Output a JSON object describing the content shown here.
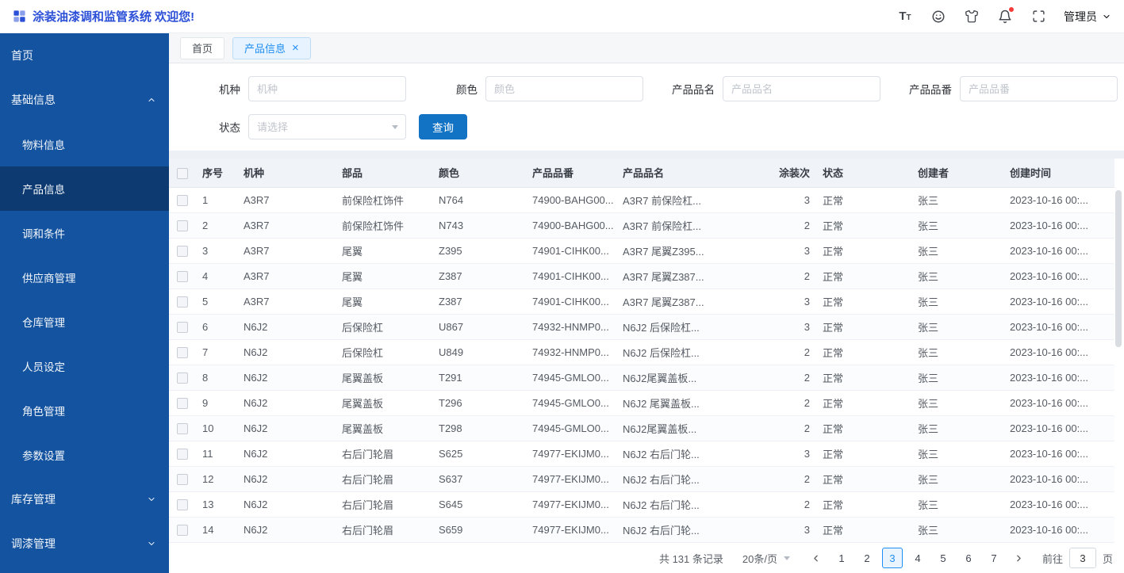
{
  "header": {
    "title": "涂装油漆调和监管系统 欢迎您!",
    "user_label": "管理员"
  },
  "sidebar": {
    "items": [
      {
        "label": "首页",
        "level": 1
      },
      {
        "label": "基础信息",
        "level": 1,
        "chevron": "up"
      },
      {
        "label": "物料信息",
        "level": 2
      },
      {
        "label": "产品信息",
        "level": 2,
        "active": true
      },
      {
        "label": "调和条件",
        "level": 2
      },
      {
        "label": "供应商管理",
        "level": 2
      },
      {
        "label": "仓库管理",
        "level": 2
      },
      {
        "label": "人员设定",
        "level": 2
      },
      {
        "label": "角色管理",
        "level": 2
      },
      {
        "label": "参数设置",
        "level": 2
      },
      {
        "label": "库存管理",
        "level": 1,
        "chevron": "down"
      },
      {
        "label": "调漆管理",
        "level": 1,
        "chevron": "down"
      }
    ]
  },
  "tabs": [
    {
      "label": "首页",
      "active": false,
      "closable": false
    },
    {
      "label": "产品信息",
      "active": true,
      "closable": true
    }
  ],
  "search": {
    "fields": [
      {
        "label": "机种",
        "placeholder": "机种"
      },
      {
        "label": "颜色",
        "placeholder": "颜色"
      },
      {
        "label": "产品品名",
        "placeholder": "产品品名"
      },
      {
        "label": "产品品番",
        "placeholder": "产品品番"
      }
    ],
    "status_label": "状态",
    "status_placeholder": "请选择",
    "query_label": "查询"
  },
  "table": {
    "columns": [
      {
        "key": "no",
        "label": "序号"
      },
      {
        "key": "model",
        "label": "机种"
      },
      {
        "key": "part",
        "label": "部品"
      },
      {
        "key": "color",
        "label": "颜色"
      },
      {
        "key": "part_no",
        "label": "产品品番"
      },
      {
        "key": "name",
        "label": "产品品名"
      },
      {
        "key": "times",
        "label": "涂装次",
        "align": "right"
      },
      {
        "key": "status",
        "label": "状态"
      },
      {
        "key": "creator",
        "label": "创建者"
      },
      {
        "key": "created",
        "label": "创建时间"
      }
    ],
    "rows": [
      {
        "no": "1",
        "model": "A3R7",
        "part": "前保险杠饰件",
        "color": "N764",
        "part_no": "74900-BAHG00...",
        "name": "A3R7 前保险杠...",
        "times": "3",
        "status": "正常",
        "creator": "张三",
        "created": "2023-10-16 00:..."
      },
      {
        "no": "2",
        "model": "A3R7",
        "part": "前保险杠饰件",
        "color": "N743",
        "part_no": "74900-BAHG00...",
        "name": "A3R7 前保险杠...",
        "times": "2",
        "status": "正常",
        "creator": "张三",
        "created": "2023-10-16 00:..."
      },
      {
        "no": "3",
        "model": "A3R7",
        "part": "尾翼",
        "color": "Z395",
        "part_no": "74901-CIHK00...",
        "name": "A3R7 尾翼Z395...",
        "times": "3",
        "status": "正常",
        "creator": "张三",
        "created": "2023-10-16 00:..."
      },
      {
        "no": "4",
        "model": "A3R7",
        "part": "尾翼",
        "color": "Z387",
        "part_no": "74901-CIHK00...",
        "name": "A3R7 尾翼Z387...",
        "times": "2",
        "status": "正常",
        "creator": "张三",
        "created": "2023-10-16 00:..."
      },
      {
        "no": "5",
        "model": "A3R7",
        "part": "尾翼",
        "color": "Z387",
        "part_no": "74901-CIHK00...",
        "name": "A3R7 尾翼Z387...",
        "times": "3",
        "status": "正常",
        "creator": "张三",
        "created": "2023-10-16 00:..."
      },
      {
        "no": "6",
        "model": "N6J2",
        "part": "后保险杠",
        "color": "U867",
        "part_no": "74932-HNMP0...",
        "name": "N6J2 后保险杠...",
        "times": "3",
        "status": "正常",
        "creator": "张三",
        "created": "2023-10-16 00:..."
      },
      {
        "no": "7",
        "model": "N6J2",
        "part": "后保险杠",
        "color": "U849",
        "part_no": "74932-HNMP0...",
        "name": "N6J2 后保险杠...",
        "times": "2",
        "status": "正常",
        "creator": "张三",
        "created": "2023-10-16 00:..."
      },
      {
        "no": "8",
        "model": "N6J2",
        "part": "尾翼盖板",
        "color": "T291",
        "part_no": "74945-GMLO0...",
        "name": "N6J2尾翼盖板...",
        "times": "2",
        "status": "正常",
        "creator": "张三",
        "created": "2023-10-16 00:..."
      },
      {
        "no": "9",
        "model": "N6J2",
        "part": "尾翼盖板",
        "color": "T296",
        "part_no": "74945-GMLO0...",
        "name": "N6J2 尾翼盖板...",
        "times": "2",
        "status": "正常",
        "creator": "张三",
        "created": "2023-10-16 00:..."
      },
      {
        "no": "10",
        "model": "N6J2",
        "part": "尾翼盖板",
        "color": "T298",
        "part_no": "74945-GMLO0...",
        "name": "N6J2尾翼盖板...",
        "times": "2",
        "status": "正常",
        "creator": "张三",
        "created": "2023-10-16 00:..."
      },
      {
        "no": "11",
        "model": "N6J2",
        "part": "右后门轮眉",
        "color": "S625",
        "part_no": "74977-EKIJM0...",
        "name": "N6J2 右后门轮...",
        "times": "3",
        "status": "正常",
        "creator": "张三",
        "created": "2023-10-16 00:..."
      },
      {
        "no": "12",
        "model": "N6J2",
        "part": "右后门轮眉",
        "color": "S637",
        "part_no": "74977-EKIJM0...",
        "name": "N6J2 右后门轮...",
        "times": "2",
        "status": "正常",
        "creator": "张三",
        "created": "2023-10-16 00:..."
      },
      {
        "no": "13",
        "model": "N6J2",
        "part": "右后门轮眉",
        "color": "S645",
        "part_no": "74977-EKIJM0...",
        "name": "N6J2 右后门轮...",
        "times": "2",
        "status": "正常",
        "creator": "张三",
        "created": "2023-10-16 00:..."
      },
      {
        "no": "14",
        "model": "N6J2",
        "part": "右后门轮眉",
        "color": "S659",
        "part_no": "74977-EKIJM0...",
        "name": "N6J2 右后门轮...",
        "times": "3",
        "status": "正常",
        "creator": "张三",
        "created": "2023-10-16 00:..."
      }
    ]
  },
  "pagination": {
    "total_text": "共 131 条记录",
    "page_size_label": "20条/页",
    "pages": [
      "1",
      "2",
      "3",
      "4",
      "5",
      "6",
      "7"
    ],
    "current": "3",
    "goto_label": "前往",
    "goto_value": "3",
    "goto_unit": "页"
  },
  "colors": {
    "sidebar_blue": "#14539f",
    "sidebar_active_blue": "#0c3a71",
    "title_blue": "#2b4fd7",
    "button_blue": "#1273c5",
    "accent_blue": "#1e8ef5",
    "badge_red": "#f53a3a",
    "table_header_bg": "#f0f4f9"
  }
}
